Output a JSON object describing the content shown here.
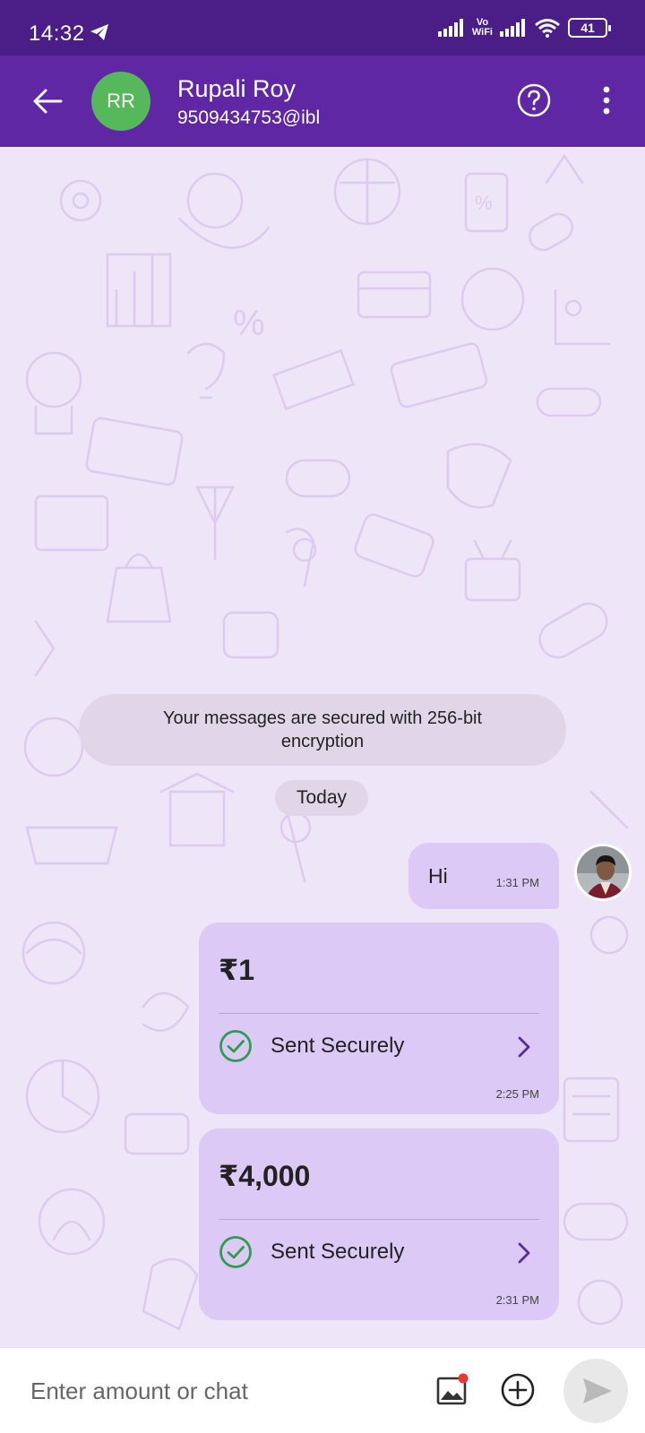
{
  "status_bar": {
    "time": "14:32",
    "vowifi_top": "Vo",
    "vowifi_bottom": "WiFi",
    "battery": "41"
  },
  "header": {
    "initials": "RR",
    "name": "Rupali Roy",
    "vpa": "9509434753@ibl",
    "avatar_color": "#56b85b",
    "bar_color": "#6027a5"
  },
  "chat": {
    "encryption_notice": "Your messages are secured with 256-bit encryption",
    "date_label": "Today",
    "messages": [
      {
        "type": "text",
        "text": "Hi",
        "time": "1:31 PM"
      }
    ],
    "payments": [
      {
        "amount": "₹1",
        "status": "Sent Securely",
        "time": "2:25 PM"
      },
      {
        "amount": "₹4,000",
        "status": "Sent Securely",
        "time": "2:31 PM"
      }
    ]
  },
  "composer": {
    "placeholder": "Enter amount or chat"
  },
  "colors": {
    "accent": "#6027a5",
    "bubble": "#dcc9f5",
    "success": "#2e9d4e"
  },
  "icons": [
    "back-arrow-icon",
    "help-icon",
    "more-vert-icon",
    "check-circle-icon",
    "chevron-right-icon",
    "gallery-icon",
    "plus-circle-icon",
    "send-icon"
  ]
}
